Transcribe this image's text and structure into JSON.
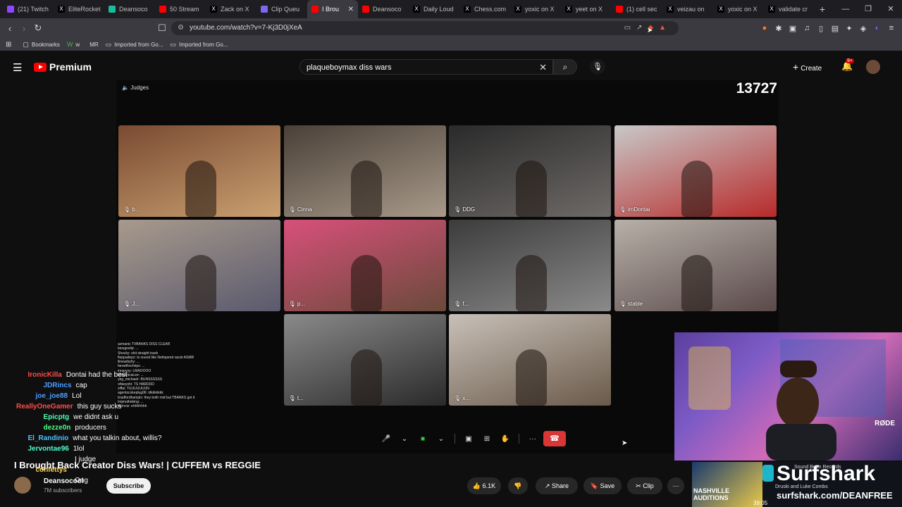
{
  "browser": {
    "tabs": [
      {
        "label": "(21) Twitch",
        "icon": "twitch-icon",
        "color": "#9146ff"
      },
      {
        "label": "EliteRocket",
        "icon": "x-icon",
        "color": "#000000"
      },
      {
        "label": "Deansoco",
        "icon": "dean-icon",
        "color": "#1abc9c"
      },
      {
        "label": "50 Stream",
        "icon": "youtube-icon",
        "color": "#ff0000"
      },
      {
        "label": "Zack on X",
        "icon": "x-icon",
        "color": "#000000"
      },
      {
        "label": "Clip Queu",
        "icon": "clip-icon",
        "color": "#7b68ee"
      },
      {
        "label": "I Brou",
        "icon": "youtube-icon",
        "color": "#ff0000",
        "active": true
      },
      {
        "label": "Deansoco",
        "icon": "youtube-icon",
        "color": "#ff0000"
      },
      {
        "label": "Daily Loud",
        "icon": "x-icon",
        "color": "#000000"
      },
      {
        "label": "Chess.com",
        "icon": "x-icon",
        "color": "#000000"
      },
      {
        "label": "yoxic on X",
        "icon": "x-icon",
        "color": "#000000"
      },
      {
        "label": "yeet on X",
        "icon": "x-icon",
        "color": "#000000"
      },
      {
        "label": "(1) cell sec",
        "icon": "youtube-icon",
        "color": "#ff0000"
      },
      {
        "label": "veizau on",
        "icon": "x-icon",
        "color": "#000000"
      },
      {
        "label": "yoxic on X",
        "icon": "x-icon",
        "color": "#000000"
      },
      {
        "label": "validate cr",
        "icon": "x-icon",
        "color": "#000000"
      }
    ],
    "url": "youtube.com/watch?v=7-Kj3D0jXeA",
    "bookmarks": [
      {
        "label": "Bookmarks",
        "icon": "bookmark-icon"
      },
      {
        "label": "w",
        "icon": "w-icon"
      },
      {
        "label": "MR",
        "icon": "mr-icon"
      },
      {
        "label": "Imported from Go...",
        "icon": "folder-icon"
      },
      {
        "label": "Imported from Go...",
        "icon": "folder-icon"
      }
    ]
  },
  "youtube": {
    "logo_text": "Premium",
    "search_query": "plaqueboymax diss wars",
    "create_label": "Create",
    "notifications_badge": "9+"
  },
  "video": {
    "judges_label": "Judges",
    "counter": "13727",
    "cams": [
      {
        "name": "b...",
        "colors": [
          "#7a4a32",
          "#caa070"
        ]
      },
      {
        "name": "Cinna",
        "colors": [
          "#4a4038",
          "#a89a8a"
        ]
      },
      {
        "name": "DDG",
        "colors": [
          "#2a2a2a",
          "#6e6a68"
        ]
      },
      {
        "name": "imDontai",
        "colors": [
          "#c8c8c8",
          "#b82a2a"
        ]
      },
      {
        "name": "J...",
        "colors": [
          "#a89a8c",
          "#5a5a6e"
        ]
      },
      {
        "name": "p...",
        "colors": [
          "#d8507a",
          "#6a4a3a"
        ]
      },
      {
        "name": "f...",
        "colors": [
          "#3c3c3c",
          "#8a8a8a"
        ]
      },
      {
        "name": "stable",
        "colors": [
          "#b8b0a8",
          "#5a4a4a"
        ]
      },
      {
        "name": "t...",
        "colors": [
          "#8a8a8a",
          "#2a2a2a"
        ]
      },
      {
        "name": "x...",
        "colors": [
          "#c8c0b8",
          "#6a5a4a"
        ]
      }
    ],
    "small_chat": [
      "azmanic TVBANKS DISS CLEAR",
      "lanugoslip: ...",
      "Shocky: shit straight trash",
      "fleppadepz: ts sound like Nettspend racist ASMR",
      "ilinearbyhy: ...",
      "fanwithvchrips: ...",
      "innaryyy: LMAOOOO",
      "MasonicaLee: ...",
      "ybg_michaelr: BUNSSSSSS",
      "ohkeyohi: TS HARDDD",
      "ziffai: TUUUUUUUN",
      "agentscokeplug06: idkkkkkkk",
      "bradfordhamplx: they both mid but TBANKS got it",
      "Imjmotheking: ...",
      "vicinctz: ehhhhhhh"
    ],
    "chat": [
      {
        "user": "IronicKilla",
        "color": "#ff4d4d",
        "msg": "Dontai had the best"
      },
      {
        "user": "JDRincs",
        "color": "#4d9fff",
        "msg": "cap"
      },
      {
        "user": "joe_joe88",
        "color": "#4d9fff",
        "msg": "Lol"
      },
      {
        "user": "ReallyOneGamer",
        "color": "#ff4d4d",
        "msg": "this guy sucks"
      },
      {
        "user": "Epicptg",
        "color": "#4dffb5",
        "msg": "we didnt ask u"
      },
      {
        "user": "dezze0n",
        "color": "#4dff88",
        "msg": "producers"
      },
      {
        "user": "El_Randinio",
        "color": "#4dc3ff",
        "msg": "what you talkin about, willis?"
      },
      {
        "user": "Jervontae96",
        "color": "#4dffd0",
        "msg": "1lol"
      },
      {
        "user": "",
        "color": "#b266ff",
        "msg": "I judge"
      },
      {
        "user": "confettys",
        "color": "#ffd24d",
        "msg": ""
      },
      {
        "user": "",
        "color": "#4dff88",
        "msg": "Ong"
      }
    ],
    "callbar_icons": [
      "mic-icon",
      "chevron-icon",
      "camera-icon",
      "chevron-icon",
      "screen-share-icon",
      "grid-icon",
      "effects-icon",
      "more-icon"
    ]
  },
  "overlay": {
    "ad_brand": "Surfshark",
    "ad_url": "surfshark.com/DEANFREE",
    "ad_time": "39:05",
    "ad_credits": "Druski and Luke Combs",
    "ad_label": "NASHVILLE AUDITIONS",
    "ad_records": "Sound Been Records",
    "webcam_sign": "RØDE"
  },
  "meta": {
    "title": "I Brought Back Creator Diss Wars! | CUFFEM vs REGGIE",
    "channel": "Deansocool",
    "subscribers": "7M subscribers",
    "subscribe_label": "Subscribe",
    "likes": "6.1K",
    "share_label": "Share",
    "save_label": "Save",
    "clip_label": "Clip"
  }
}
